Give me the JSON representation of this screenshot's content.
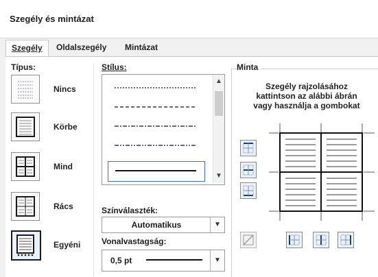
{
  "window": {
    "title": "Szegély és mintázat"
  },
  "tabs": [
    {
      "label": "Szegély",
      "active": true
    },
    {
      "label": "Oldalszegély",
      "active": false
    },
    {
      "label": "Mintázat",
      "active": false
    }
  ],
  "types": {
    "heading": "Típus:",
    "items": [
      {
        "label": "Nincs",
        "icon": "border-none-icon"
      },
      {
        "label": "Körbe",
        "icon": "border-box-icon"
      },
      {
        "label": "Mind",
        "icon": "border-all-icon"
      },
      {
        "label": "Rács",
        "icon": "border-grid-icon"
      },
      {
        "label": "Egyéni",
        "icon": "border-custom-icon",
        "selected": true
      }
    ]
  },
  "style": {
    "heading": "Stílus:",
    "line_styles": [
      "dotted",
      "dashed",
      "dash-dot",
      "dash-dot-dot",
      "solid"
    ],
    "selected": "solid"
  },
  "color": {
    "label": "Színválaszték:",
    "value": "Automatikus"
  },
  "width": {
    "label": "Vonalvastagság:",
    "value": "0,5 pt"
  },
  "preview": {
    "heading": "Minta",
    "instruction_line1": "Szegély rajzolásához",
    "instruction_line2": "kattintson az alábbi ábrán",
    "instruction_line3": "vagy használja a gombokat"
  }
}
